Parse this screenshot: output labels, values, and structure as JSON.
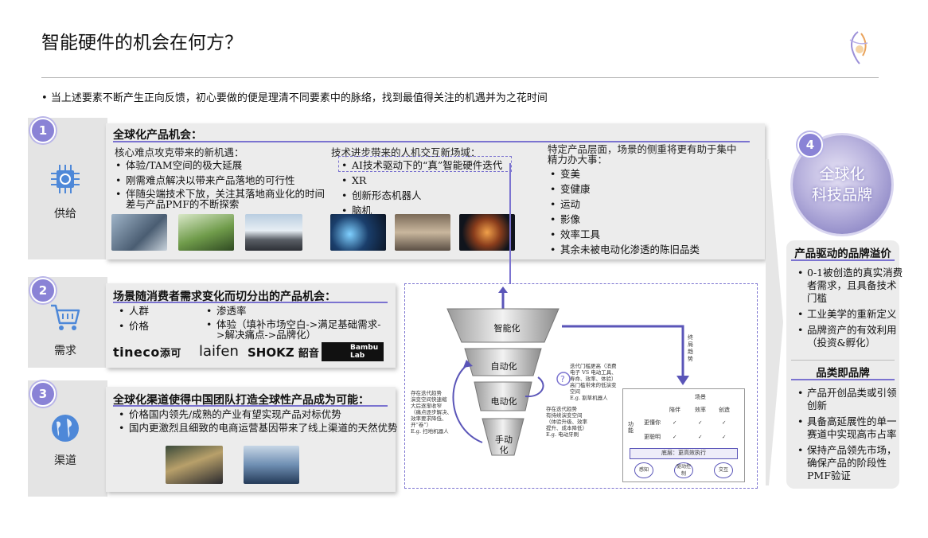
{
  "title": "智能硬件的机会在何方？",
  "intro": "当上述要素不断产生正向反馈，初心要做的便是理清不同要素中的脉络，找到最值得关注的机遇并为之花时间",
  "supply": {
    "badge": "1",
    "label": "供给",
    "heading": "全球化产品机会：",
    "col1": {
      "sub": "核心难点攻克带来的新机遇：",
      "items": [
        "体验/TAM空间的极大延展",
        "刚需难点解决以带来产品落地的可行性",
        "伴随尖端技术下放，关注其落地商业化的时间差与产品PMF的不断探索"
      ]
    },
    "col2": {
      "sub": "技术进步带来的人机交互新场域：",
      "items": [
        "AI技术驱动下的“真”智能硬件迭代",
        "XR",
        "创新形态机器人",
        "脑机"
      ]
    },
    "col3": {
      "sub": "特定产品层面，场景的侧重将更有助于集中精力办大事：",
      "items": [
        "变美",
        "变健康",
        "运动",
        "影像",
        "效率工具",
        "其余未被电动化渗透的陈旧品类"
      ]
    }
  },
  "demand": {
    "badge": "2",
    "label": "需求",
    "heading": "场景随消费者需求变化而切分出的产品机会：",
    "left_items": [
      "人群",
      "价格"
    ],
    "right_items": [
      "渗透率",
      "体验（填补市场空白->满足基础需求->解决痛点->品牌化）"
    ],
    "logos": [
      "tineco",
      "添可",
      "laifen",
      "SHOKZ",
      "韶音",
      "Bambu",
      "Lab"
    ]
  },
  "channel": {
    "badge": "3",
    "label": "渠道",
    "heading": "全球化渠道使得中国团队打造全球性产品成为可能：",
    "items": [
      "价格国内领先/成熟的产业有望实现产品对标优势",
      "国内更激烈且细致的电商运营基因带来了线上渠道的天然优势"
    ]
  },
  "funnel": {
    "levels": [
      "智能化",
      "自动化",
      "电动化",
      "手动化"
    ],
    "note_left_top": [
      "存在迭代趋势",
      "演变空间快速缩",
      "大后逐渐收窄",
      "（痛点逐步解决、",
      "效率要求降低、",
      "开“卷”）",
      "E.g. 扫地机器人"
    ],
    "note_right_top": [
      "迭代门槛更高（消费",
      "电子 VS 电动工具、",
      "寿命、效率、体验）",
      "高门槛带来的低演变",
      "空间",
      "E.g. 割草机器人"
    ],
    "note_right_mid": [
      "存在迭代趋势",
      "有持续演变空间",
      "（体验升级、效率",
      "提升、成本降低）",
      "E.g. 电动牙刷"
    ],
    "arrow_label": "终局趋势",
    "table": {
      "title": "场景",
      "cols": [
        "陪伴",
        "效率",
        "创造"
      ],
      "row_group": "功能",
      "rows": [
        {
          "label": "更懂你",
          "cells": [
            "✓",
            "✓",
            "✓"
          ]
        },
        {
          "label": "更聪明",
          "cells": [
            "✓",
            "✓",
            "✓"
          ]
        }
      ],
      "base": "底层：更高效执行",
      "circles": [
        "感知",
        "驱动控制",
        "交互"
      ]
    }
  },
  "brand": {
    "badge": "4",
    "orb_text": [
      "全球化",
      "科技品牌"
    ],
    "sec1_title": "产品驱动的品牌溢价",
    "sec1_items": [
      "0-1被创造的真实消费者需求，且具备技术门槛",
      "工业美学的重新定义",
      "品牌资产的有效利用（投资&孵化）"
    ],
    "sec2_title": "品类即品牌",
    "sec2_items": [
      "产品开创品类或引领创新",
      "具备高延展性的单一赛道中实现高市占率",
      "保持产品领先市场，确保产品的阶段性PMF验证"
    ]
  },
  "colors": {
    "accent": "#7b73d0",
    "badge": "#8a83d6",
    "panel": "#ececec"
  }
}
